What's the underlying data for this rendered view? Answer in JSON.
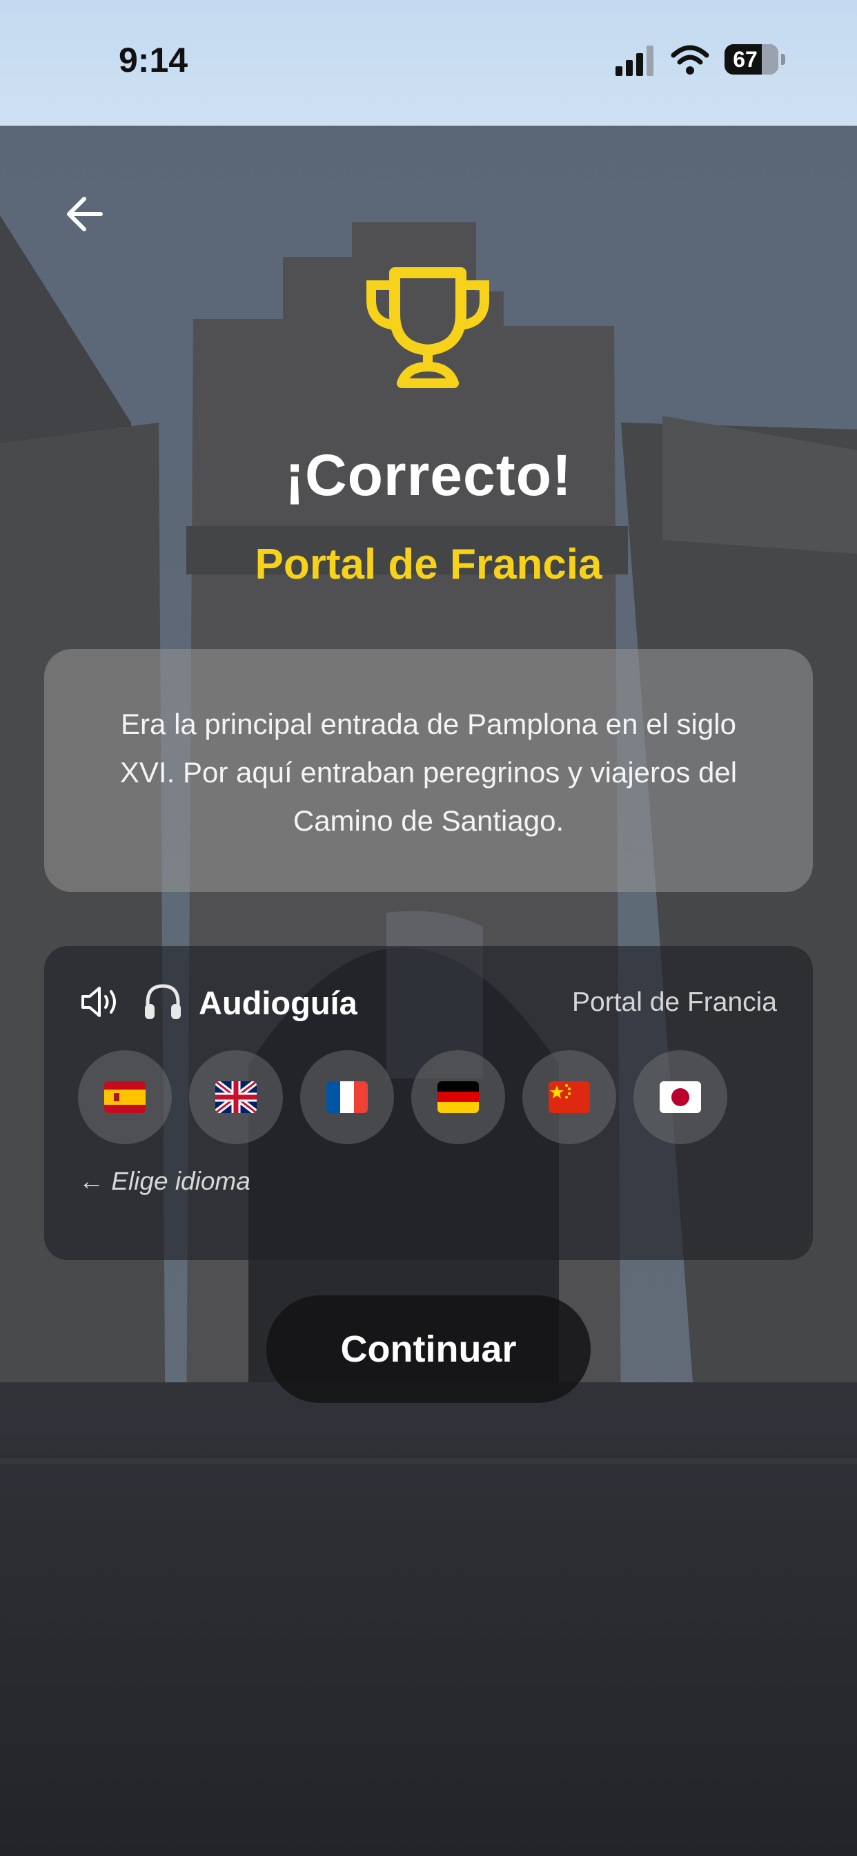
{
  "status_bar": {
    "time": "9:14",
    "battery": "67"
  },
  "header": {
    "back_icon": "arrow-left-icon"
  },
  "result": {
    "icon": "trophy-icon",
    "title": "¡Correcto!",
    "place_name": "Portal de Francia",
    "description": "Era la principal entrada de Pamplona en el siglo XVI. Por aquí entraban peregrinos y viajeros del Camino de Santiago."
  },
  "audio_guide": {
    "icons": [
      "speaker-icon",
      "headphones-icon"
    ],
    "label": "Audioguía",
    "location": "Portal de Francia",
    "languages": [
      {
        "flag": "spain-flag-icon"
      },
      {
        "flag": "uk-flag-icon"
      },
      {
        "flag": "france-flag-icon"
      },
      {
        "flag": "germany-flag-icon"
      },
      {
        "flag": "china-flag-icon"
      },
      {
        "flag": "japan-flag-icon"
      }
    ],
    "choose_hint": "← Elige idioma"
  },
  "actions": {
    "continue_label": "Continuar"
  },
  "colors": {
    "accent": "#f7d21a",
    "overlay": "#2a2c31"
  }
}
